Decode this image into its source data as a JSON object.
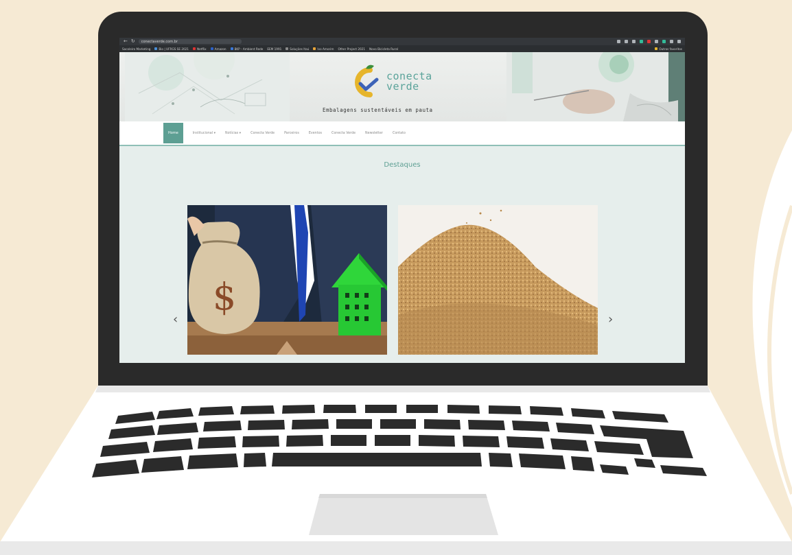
{
  "colors": {
    "background": "#f6ead4",
    "laptop_bezel": "#2a2a2a",
    "laptop_body": "#ffffff",
    "brand_teal": "#5d9f93",
    "logo_yellow": "#e6b52c",
    "logo_blue": "#3d63b8",
    "key_color": "#2b2b2b"
  },
  "browser": {
    "url": "conectaverde.com.br",
    "bookmarks": [
      "Sacoleiro Marketing",
      "Bio | UFRGS SE 2021",
      "Netflix",
      "Amazon",
      "BKP - Ambient Rede",
      "EEM 1991",
      "Soluções Itaú",
      "Ivo Amorim",
      "Other Project 2021",
      "Novo Bicicleta Rural"
    ],
    "bookmarks_right": "Outros favoritos"
  },
  "site": {
    "logo_line1": "conecta",
    "logo_line2": "verde",
    "tagline": "Embalagens sustentáveis em pauta",
    "nav": [
      {
        "label": "Home",
        "active": true
      },
      {
        "label": "Institucional ▾",
        "active": false
      },
      {
        "label": "Notícias ▾",
        "active": false
      },
      {
        "label": "Conecta Verde",
        "active": false
      },
      {
        "label": "Parceiros",
        "active": false
      },
      {
        "label": "Eventos",
        "active": false
      },
      {
        "label": "Conecta Verde",
        "active": false
      },
      {
        "label": "Newsletter",
        "active": false
      },
      {
        "label": "Contato",
        "active": false
      }
    ],
    "section_title": "Destaques",
    "slider": {
      "prev": "‹",
      "next": "›",
      "slides": [
        {
          "name": "money-bag-and-green-house",
          "glyph": "$"
        },
        {
          "name": "brown-sugar-pile"
        }
      ]
    }
  }
}
